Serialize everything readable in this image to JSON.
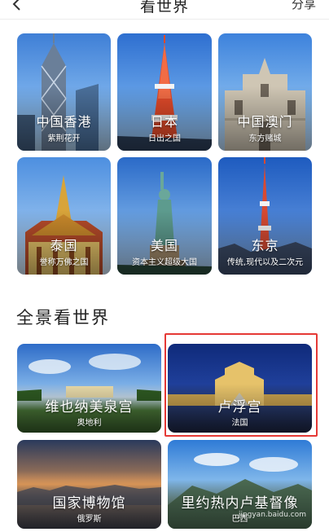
{
  "header": {
    "title": "看世界",
    "share_label": "分享"
  },
  "grid": [
    {
      "title": "中国香港",
      "subtitle": "紫荆花开"
    },
    {
      "title": "日本",
      "subtitle": "日出之国"
    },
    {
      "title": "中国澳门",
      "subtitle": "东方赌城"
    },
    {
      "title": "泰国",
      "subtitle": "誉称万佛之国"
    },
    {
      "title": "美国",
      "subtitle": "资本主义超级大国"
    },
    {
      "title": "东京",
      "subtitle": "传统,现代以及二次元"
    }
  ],
  "panorama": {
    "section_title": "全景看世界",
    "items": [
      {
        "title": "维也纳美泉宫",
        "subtitle": "奥地利"
      },
      {
        "title": "卢浮宫",
        "subtitle": "法国"
      },
      {
        "title": "国家博物馆",
        "subtitle": "俄罗斯"
      },
      {
        "title": "里约热内卢基督像",
        "subtitle": "巴西"
      }
    ]
  },
  "watermark": "jingyan.baidu.com",
  "colors": {
    "highlight_border": "#e53935",
    "background": "#ffffff"
  }
}
